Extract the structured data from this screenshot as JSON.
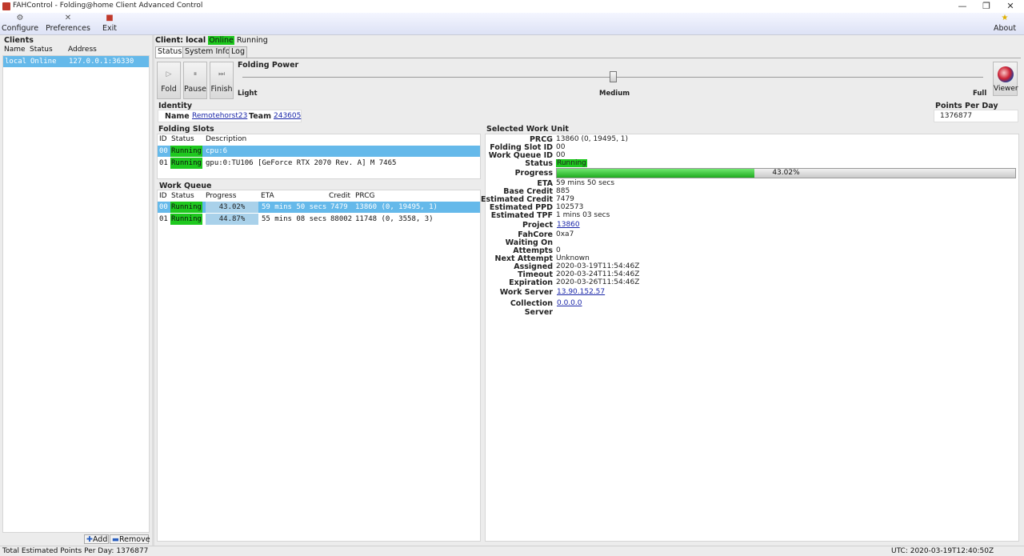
{
  "window": {
    "title": "FAHControl - Folding@home Client Advanced Control",
    "controls": [
      "—",
      "❐",
      "✕"
    ]
  },
  "toolbar": {
    "configure": "Configure",
    "preferences": "Preferences",
    "exit": "Exit",
    "about": "About"
  },
  "clients": {
    "header": "Clients",
    "columns": [
      "Name",
      "Status",
      "Address"
    ],
    "rows": [
      {
        "name": "local",
        "status": "Online",
        "address": "127.0.0.1:36330"
      }
    ],
    "add": "Add",
    "remove": "Remove"
  },
  "client": {
    "label": "Client:",
    "name": "local",
    "state": "Online",
    "status": "Running"
  },
  "tabs": [
    "Status",
    "System Info",
    "Log"
  ],
  "actions": {
    "fold": "Fold",
    "pause": "Pause",
    "finish": "Finish",
    "viewer": "Viewer"
  },
  "folding_power": {
    "title": "Folding Power",
    "light": "Light",
    "medium": "Medium",
    "full": "Full",
    "level": 0.5
  },
  "identity": {
    "title": "Identity",
    "name_label": "Name",
    "name": "Remotehorst23",
    "team_label": "Team",
    "team": "243605"
  },
  "ppd": {
    "title": "Points Per Day",
    "value": "1376877"
  },
  "slots": {
    "title": "Folding Slots",
    "columns": [
      "ID",
      "Status",
      "Description"
    ],
    "rows": [
      {
        "id": "00",
        "status": "Running",
        "desc": "cpu:6"
      },
      {
        "id": "01",
        "status": "Running",
        "desc": "gpu:0:TU106 [GeForce RTX 2070 Rev. A] M 7465"
      }
    ]
  },
  "queue": {
    "title": "Work Queue",
    "columns": [
      "ID",
      "Status",
      "Progress",
      "ETA",
      "Credit",
      "PRCG"
    ],
    "rows": [
      {
        "id": "00",
        "status": "Running",
        "progress": "43.02%",
        "eta": "59 mins 50 secs",
        "credit": "7479",
        "prcg": "13860 (0, 19495, 1)"
      },
      {
        "id": "01",
        "status": "Running",
        "progress": "44.87%",
        "eta": "55 mins 08 secs",
        "credit": "88002",
        "prcg": "11748 (0, 3558, 3)"
      }
    ]
  },
  "work_unit": {
    "title": "Selected Work Unit",
    "prcg_l": "PRCG",
    "prcg": "13860 (0, 19495, 1)",
    "slot_l": "Folding Slot ID",
    "slot": "00",
    "wq_l": "Work Queue ID",
    "wq": "00",
    "status_l": "Status",
    "status": "Running",
    "progress_l": "Progress",
    "progress": "43.02%",
    "progress_fraction": 0.4302,
    "eta_l": "ETA",
    "eta": "59 mins 50 secs",
    "base_l": "Base Credit",
    "base": "885",
    "est_credit_l": "Estimated Credit",
    "est_credit": "7479",
    "est_ppd_l": "Estimated PPD",
    "est_ppd": "102573",
    "est_tpf_l": "Estimated TPF",
    "est_tpf": "1 mins 03 secs",
    "project_l": "Project",
    "project": "13860",
    "core_l": "FahCore",
    "core": "0xa7",
    "waiting_l": "Waiting On",
    "waiting": "",
    "attempts_l": "Attempts",
    "attempts": "0",
    "next_l": "Next Attempt",
    "next": "Unknown",
    "assigned_l": "Assigned",
    "assigned": "2020-03-19T11:54:46Z",
    "timeout_l": "Timeout",
    "timeout": "2020-03-24T11:54:46Z",
    "expiration_l": "Expiration",
    "expiration": "2020-03-26T11:54:46Z",
    "ws_l": "Work Server",
    "ws": "13.90.152.57",
    "cs_l": "Collection Server",
    "cs": "0.0.0.0"
  },
  "statusbar": {
    "left": "Total Estimated Points Per Day: 1376877",
    "right": "UTC: 2020-03-19T12:40:50Z"
  }
}
